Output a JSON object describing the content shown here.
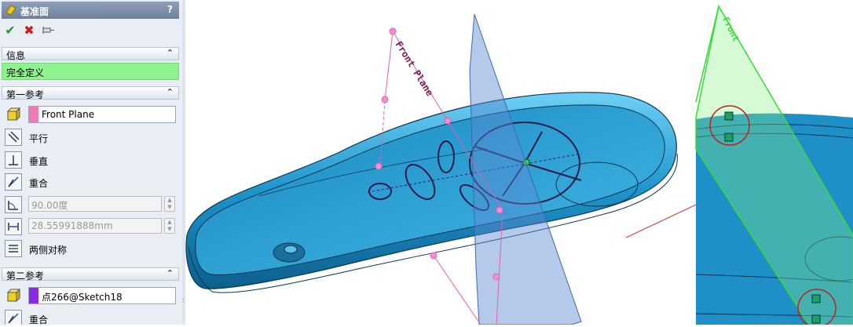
{
  "panel": {
    "title": "基准面",
    "help": "?",
    "actions": {
      "ok": "✔",
      "cancel": "✖",
      "pin": "pushpin-icon"
    },
    "info": {
      "header": "信息",
      "message": "完全定义"
    },
    "first_ref": {
      "header": "第一参考",
      "value": "Front Plane",
      "swatch_color": "#f07ab6",
      "options": {
        "parallel": "平行",
        "perpendicular": "垂直",
        "coincident": "重合",
        "angle": "90.00度",
        "distance": "28.55991888mm",
        "midplane": "两侧对称"
      }
    },
    "second_ref": {
      "header": "第二参考",
      "value": "点266@Sketch18",
      "swatch_color": "#8a2be2",
      "options": {
        "coincident": "重合"
      }
    },
    "collapse_glyph": "⌃"
  },
  "viewport": {
    "plane_label": "Front Plane",
    "zoom_label": "Front"
  },
  "colors": {
    "model": "#1f8fc7",
    "ref_plane": "#e060b0",
    "new_plane": "#5a8ad0",
    "zoom_plane": "#33dd33",
    "arrow": "#d04040"
  }
}
